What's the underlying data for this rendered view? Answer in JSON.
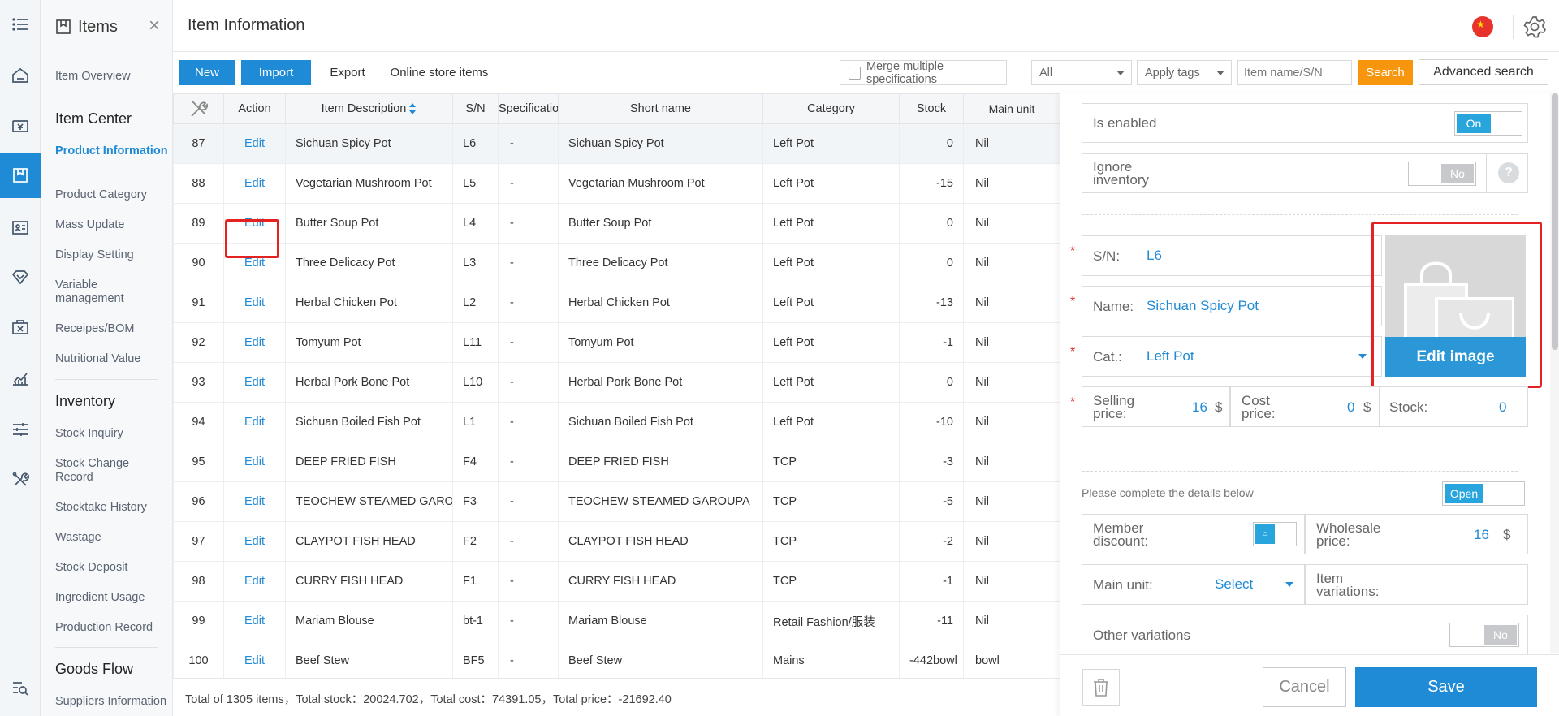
{
  "rail": {
    "icons": [
      "menu-icon",
      "home-icon",
      "payment-icon",
      "items-icon",
      "member-icon",
      "promotion-icon",
      "store-icon",
      "report-icon",
      "settings-sliders-icon",
      "tools-icon",
      "search-list-icon"
    ]
  },
  "nav": {
    "title": "Items",
    "overview": "Item Overview",
    "item_center": {
      "heading": "Item Center",
      "links": [
        "Product Information",
        "Product Category",
        "Mass Update",
        "Display Setting",
        "Variable management",
        "Receipes/BOM",
        "Nutritional Value"
      ]
    },
    "inventory": {
      "heading": "Inventory",
      "links": [
        "Stock Inquiry",
        "Stock Change Record",
        "Stocktake History",
        "Wastage",
        "Stock Deposit",
        "Ingredient Usage",
        "Production Record"
      ]
    },
    "goods_flow": {
      "heading": "Goods Flow",
      "links": [
        "Suppliers Information"
      ]
    }
  },
  "header": {
    "title": "Item Information",
    "flag_symbol": "★"
  },
  "toolbar": {
    "new_label": "New",
    "import_label": "Import",
    "export_label": "Export",
    "online_label": "Online store items",
    "merge_label": "Merge multiple specifications",
    "filter_all": "All",
    "apply_tags": "Apply tags",
    "search_placeholder": "Item name/S/N",
    "search_label": "Search",
    "advanced_label": "Advanced search"
  },
  "table": {
    "headers": [
      "",
      "Action",
      "Item Description",
      "S/N",
      "Specification",
      "Short name",
      "Category",
      "Stock",
      "Main unit"
    ],
    "edit_label": "Edit",
    "rows": [
      {
        "no": "87",
        "desc": "Sichuan Spicy Pot",
        "sn": "L6",
        "spec": "-",
        "short": "Sichuan Spicy Pot",
        "cat": "Left Pot",
        "stock": "0",
        "unit": "Nil"
      },
      {
        "no": "88",
        "desc": "Vegetarian Mushroom Pot",
        "sn": "L5",
        "spec": "-",
        "short": "Vegetarian Mushroom Pot",
        "cat": "Left Pot",
        "stock": "-15",
        "unit": "Nil"
      },
      {
        "no": "89",
        "desc": "Butter Soup Pot",
        "sn": "L4",
        "spec": "-",
        "short": "Butter Soup Pot",
        "cat": "Left Pot",
        "stock": "0",
        "unit": "Nil"
      },
      {
        "no": "90",
        "desc": "Three Delicacy Pot",
        "sn": "L3",
        "spec": "-",
        "short": "Three Delicacy Pot",
        "cat": "Left Pot",
        "stock": "0",
        "unit": "Nil"
      },
      {
        "no": "91",
        "desc": "Herbal Chicken Pot",
        "sn": "L2",
        "spec": "-",
        "short": "Herbal Chicken Pot",
        "cat": "Left Pot",
        "stock": "-13",
        "unit": "Nil"
      },
      {
        "no": "92",
        "desc": "Tomyum Pot",
        "sn": "L11",
        "spec": "-",
        "short": "Tomyum Pot",
        "cat": "Left Pot",
        "stock": "-1",
        "unit": "Nil"
      },
      {
        "no": "93",
        "desc": "Herbal Pork Bone Pot",
        "sn": "L10",
        "spec": "-",
        "short": "Herbal Pork Bone Pot",
        "cat": "Left Pot",
        "stock": "0",
        "unit": "Nil"
      },
      {
        "no": "94",
        "desc": "Sichuan Boiled Fish Pot",
        "sn": "L1",
        "spec": "-",
        "short": "Sichuan Boiled Fish Pot",
        "cat": "Left Pot",
        "stock": "-10",
        "unit": "Nil"
      },
      {
        "no": "95",
        "desc": "DEEP FRIED FISH",
        "sn": "F4",
        "spec": "-",
        "short": "DEEP FRIED FISH",
        "cat": "TCP",
        "stock": "-3",
        "unit": "Nil"
      },
      {
        "no": "96",
        "desc": "TEOCHEW STEAMED GAROUPA",
        "sn": "F3",
        "spec": "-",
        "short": "TEOCHEW STEAMED GAROUPA",
        "cat": "TCP",
        "stock": "-5",
        "unit": "Nil"
      },
      {
        "no": "97",
        "desc": "CLAYPOT FISH HEAD",
        "sn": "F2",
        "spec": "-",
        "short": "CLAYPOT FISH HEAD",
        "cat": "TCP",
        "stock": "-2",
        "unit": "Nil"
      },
      {
        "no": "98",
        "desc": "CURRY FISH HEAD",
        "sn": "F1",
        "spec": "-",
        "short": "CURRY FISH HEAD",
        "cat": "TCP",
        "stock": "-1",
        "unit": "Nil"
      },
      {
        "no": "99",
        "desc": "Mariam Blouse",
        "sn": "bt-1",
        "spec": "-",
        "short": "Mariam Blouse",
        "cat": "Retail Fashion/服装",
        "stock": "-11",
        "unit": "Nil"
      },
      {
        "no": "100",
        "desc": "Beef Stew",
        "sn": "BF5",
        "spec": "-",
        "short": "Beef Stew",
        "cat": "Mains",
        "stock": "-442bowl",
        "unit": "bowl"
      }
    ]
  },
  "footer": {
    "summary": "Total of 1305 items，Total stock：20024.702，Total cost：74391.05，Total price：-21692.40"
  },
  "panel": {
    "enabled_label": "Is enabled",
    "enabled_value": "On",
    "ignore_label": "Ignore inventory",
    "ignore_value": "No",
    "help_symbol": "?",
    "star": "*",
    "sn_label": "S/N:",
    "sn_value": "L6",
    "name_label": "Name:",
    "name_value": "Sichuan Spicy Pot",
    "cat_label": "Cat.:",
    "cat_value": "Left Pot",
    "selling_label": "Selling price:",
    "selling_value": "16",
    "cost_label": "Cost price:",
    "cost_value": "0",
    "stock_label": "Stock:",
    "stock_value": "0",
    "currency": "$",
    "edit_image_label": "Edit image",
    "details_prompt": "Please complete the details below",
    "details_toggle": "Open",
    "member_label": "Member discount:",
    "member_toggle": "○",
    "wholesale_label": "Wholesale price:",
    "wholesale_value": "16",
    "main_unit_label": "Main unit:",
    "main_unit_value": "Select",
    "variations_label": "Item variations:",
    "other_label": "Other variations",
    "other_value": "No",
    "cancel_label": "Cancel",
    "save_label": "Save"
  },
  "colors": {
    "primary": "#1f8ad6",
    "accent_orange": "#f7960c",
    "highlight_red": "#e52222"
  }
}
